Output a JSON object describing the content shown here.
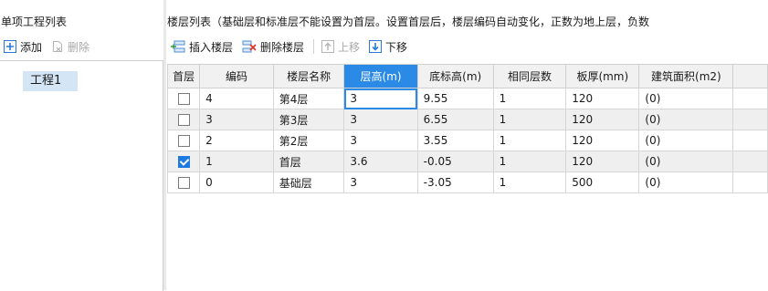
{
  "left_panel": {
    "title": "单项工程列表",
    "toolbar": {
      "add_label": "添加",
      "delete_label": "删除"
    },
    "tree": {
      "items": [
        {
          "label": "工程1"
        }
      ]
    }
  },
  "right_panel": {
    "title": "楼层列表（基础层和标准层不能设置为首层。设置首层后，楼层编码自动变化，正数为地上层，负数",
    "toolbar": {
      "insert_label": "插入楼层",
      "delete_label": "删除楼层",
      "move_up_label": "上移",
      "move_down_label": "下移"
    },
    "columns": [
      "首层",
      "编码",
      "楼层名称",
      "层高(m)",
      "底标高(m)",
      "相同层数",
      "板厚(mm)",
      "建筑面积(m2)"
    ],
    "rows": [
      {
        "is_first": false,
        "code": "4",
        "name": "第4层",
        "height": "3",
        "bottom": "9.55",
        "same": "1",
        "thickness": "120",
        "area": "(0)"
      },
      {
        "is_first": false,
        "code": "3",
        "name": "第3层",
        "height": "3",
        "bottom": "6.55",
        "same": "1",
        "thickness": "120",
        "area": "(0)"
      },
      {
        "is_first": false,
        "code": "2",
        "name": "第2层",
        "height": "3",
        "bottom": "3.55",
        "same": "1",
        "thickness": "120",
        "area": "(0)"
      },
      {
        "is_first": true,
        "code": "1",
        "name": "首层",
        "height": "3.6",
        "bottom": "-0.05",
        "same": "1",
        "thickness": "120",
        "area": "(0)"
      },
      {
        "is_first": false,
        "code": "0",
        "name": "基础层",
        "height": "3",
        "bottom": "-3.05",
        "same": "1",
        "thickness": "500",
        "area": "(0)"
      }
    ]
  },
  "colors": {
    "accent": "#2a8ae6",
    "checkbox": "#1d7ae0",
    "selection": "#d4e5f5"
  }
}
